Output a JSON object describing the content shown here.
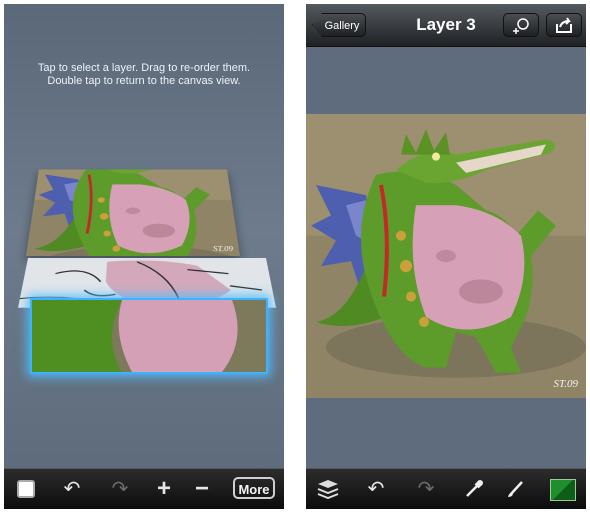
{
  "left_screen": {
    "hint_line1": "Tap to select a layer. Drag to re-order them.",
    "hint_line2": "Double tap to return to the canvas view.",
    "signature": "ST.09",
    "toolbar": {
      "icons": [
        "square-icon",
        "undo-icon",
        "redo-icon",
        "add-icon",
        "remove-icon"
      ],
      "more_label": "More"
    }
  },
  "right_screen": {
    "nav": {
      "gallery_label": "Gallery",
      "title": "Layer 3",
      "icons": [
        "add-layer-icon",
        "share-icon"
      ]
    },
    "signature": "ST.09",
    "toolbar": {
      "icons": [
        "layers-icon",
        "undo-icon",
        "redo-icon",
        "eyedropper-icon",
        "brush-icon",
        "color-swatch"
      ]
    }
  },
  "colors": {
    "selection_glow": "#3fb2ff",
    "dragon_green": "#5e9a2a",
    "belly_pink": "#d9a0b4",
    "wing_blue": "#5a63b8",
    "background_tan": "#9a8a66",
    "active_color": "#1f8f2d"
  }
}
